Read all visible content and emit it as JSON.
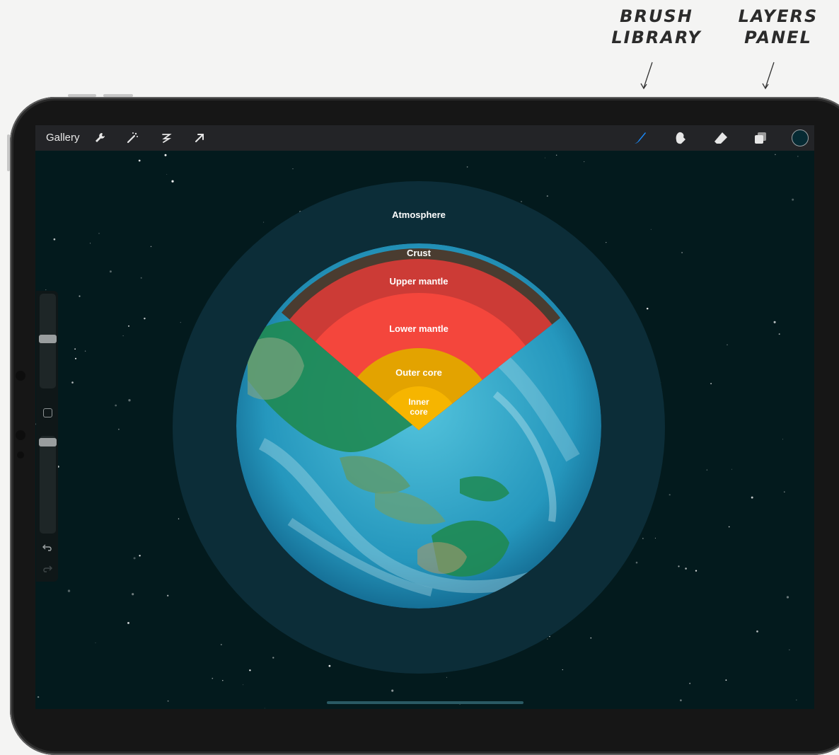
{
  "annotations": {
    "brush_library": "BRUSH LIBRARY",
    "layers_panel": "LAYERS PANEL"
  },
  "toolbar": {
    "gallery_label": "Gallery",
    "left_tools": [
      "wrench-icon",
      "magic-wand-icon",
      "selection-icon",
      "transform-arrow-icon"
    ],
    "right_tools": [
      "brush-icon",
      "smudge-icon",
      "eraser-icon",
      "layers-icon"
    ],
    "active_tool": "brush-icon",
    "accent_color": "#1a8cff",
    "current_color": "#062a33"
  },
  "sidebar": {
    "controls": [
      "brush-size-slider",
      "modify-button",
      "brush-opacity-slider",
      "undo-button",
      "redo-button"
    ]
  },
  "diagram": {
    "layers": {
      "atmosphere": "Atmosphere",
      "crust": "Crust",
      "upper_mantle": "Upper mantle",
      "lower_mantle": "Lower mantle",
      "outer_core": "Outer core",
      "inner_core_line1": "Inner",
      "inner_core_line2": "core"
    },
    "colors": {
      "background": "#031a1d",
      "atmosphere": "#0c2d38",
      "crust": "#4a3c30",
      "upper_mantle": "#cc3b36",
      "lower_mantle": "#f4463c",
      "outer_core": "#e3a300",
      "inner_core": "#f6b500",
      "ocean": "#2aa8c8",
      "land": "#1f8a52"
    }
  }
}
